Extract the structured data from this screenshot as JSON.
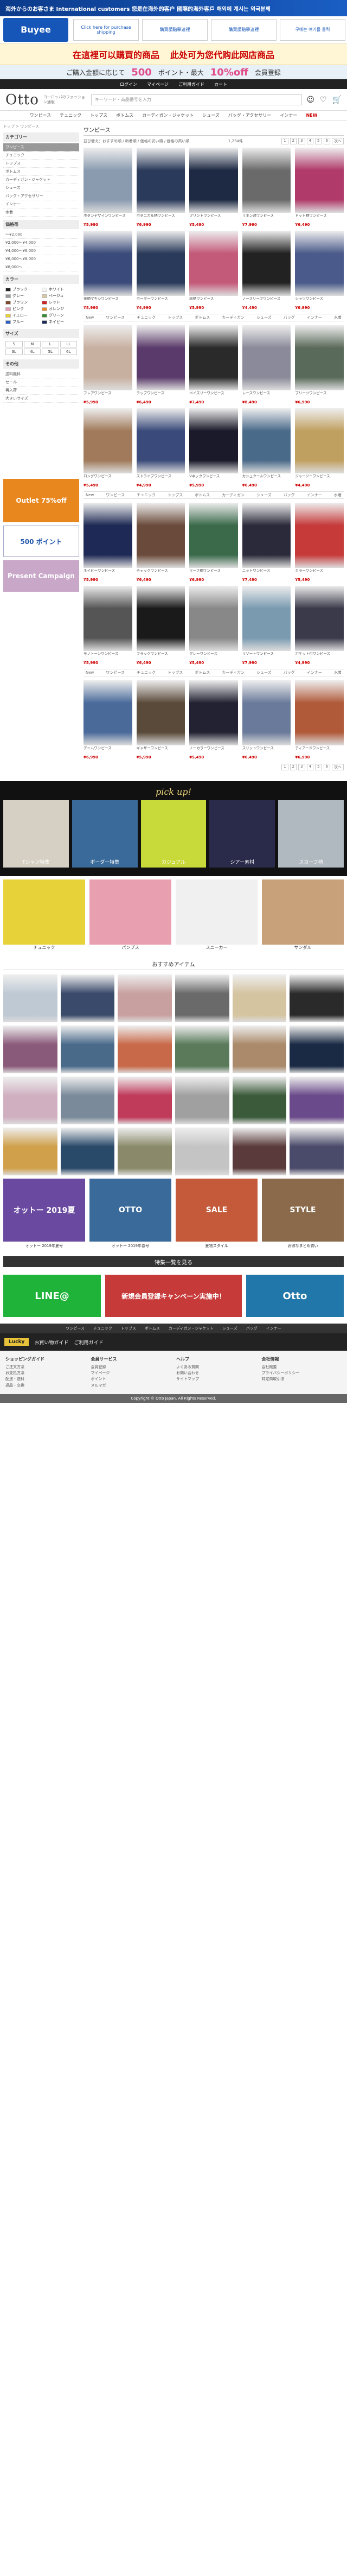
{
  "topbar": {
    "text": "海外からのお客さま International customers 您是在海外的客户 國際的海外客戶 해외에 계시는 외국분께"
  },
  "buyee": {
    "logo": "Buyee",
    "boxes": [
      "Click here for purchase shipping",
      "購買請點擊這裡",
      "購買請點擊這裡",
      "구매는 여기를 클릭"
    ]
  },
  "promo": {
    "line1": "在這裡可以購買的商品",
    "line2": "此处可为您代购此网店商品"
  },
  "points": {
    "left": "ご購入金額に応じて",
    "num": "500",
    "mid": "ポイント・最大",
    "pct": "10%off",
    "right": "会員登録"
  },
  "navbar": [
    "ログイン",
    "マイページ",
    "ご利用ガイド",
    "カート"
  ],
  "header": {
    "logo": "Otto",
    "tagline": "ヨーロッパのファッション通販",
    "search_ph": "キーワード・商品番号を入力"
  },
  "catnav": [
    "ワンピース",
    "チュニック",
    "トップス",
    "ボトムス",
    "カーディガン・ジャケット",
    "シューズ",
    "バッグ・アクセサリー",
    "インナー",
    "NEW"
  ],
  "side": {
    "crumb": "トップ > ワンピース",
    "h1": "カテゴリー",
    "cats": [
      "ワンピース",
      "チュニック",
      "トップス",
      "ボトムス",
      "カーディガン・ジャケット",
      "シューズ",
      "バッグ・アクセサリー",
      "インナー",
      "水着"
    ],
    "h2": "価格帯",
    "prices": [
      "〜¥2,000",
      "¥2,000〜¥4,000",
      "¥4,000〜¥6,000",
      "¥6,000〜¥8,000",
      "¥8,000〜"
    ],
    "h3": "カラー",
    "colors": [
      {
        "n": "ブラック",
        "c": "#222"
      },
      {
        "n": "ホワイト",
        "c": "#f5f5f5"
      },
      {
        "n": "グレー",
        "c": "#999"
      },
      {
        "n": "ベージュ",
        "c": "#d9c7a4"
      },
      {
        "n": "ブラウン",
        "c": "#7a4a2a"
      },
      {
        "n": "レッド",
        "c": "#c62828"
      },
      {
        "n": "ピンク",
        "c": "#e89bb5"
      },
      {
        "n": "オレンジ",
        "c": "#e88a2a"
      },
      {
        "n": "イエロー",
        "c": "#e8cf3a"
      },
      {
        "n": "グリーン",
        "c": "#3a8a3a"
      },
      {
        "n": "ブルー",
        "c": "#2a5ec4"
      },
      {
        "n": "ネイビー",
        "c": "#1a2a55"
      }
    ],
    "h4": "サイズ",
    "sizes": [
      "S",
      "M",
      "L",
      "LL",
      "3L",
      "4L",
      "5L",
      "6L"
    ],
    "h5": "その他",
    "others": [
      "送料無料",
      "セール",
      "再入荷",
      "大きいサイズ"
    ],
    "outlet": "Outlet 75%off",
    "newbie": "500 ポイント",
    "present": "Present Campaign"
  },
  "content": {
    "title": "ワンピース",
    "sort": "並び替え：おすすめ順 / 新着順 / 価格の安い順 / 価格の高い順",
    "count": "1,234件",
    "pages": [
      "1",
      "2",
      "3",
      "4",
      "5",
      "6",
      "次へ"
    ],
    "rowtag": [
      "New",
      "ワンピース",
      "チュニック",
      "トップス",
      "ボトムス",
      "カーディガン",
      "シューズ",
      "バッグ",
      "インナー",
      "水着"
    ]
  },
  "products": [
    {
      "n": "ボタンデザインワンピース",
      "p": "¥5,990",
      "c": "#8a9bb0"
    },
    {
      "n": "ボタニカル柄ワンピース",
      "p": "¥6,990",
      "c": "#2a3a5a"
    },
    {
      "n": "プリントワンピース",
      "p": "¥5,490",
      "c": "#1e2a44"
    },
    {
      "n": "リネン混ワンピース",
      "p": "¥7,990",
      "c": "#6a6a6a"
    },
    {
      "n": "ドット柄ワンピース",
      "p": "¥6,490",
      "c": "#b03a6a"
    },
    {
      "n": "花柄マキシワンピース",
      "p": "¥8,990",
      "c": "#3a4a7a"
    },
    {
      "n": "ボーダーワンピース",
      "p": "¥4,990",
      "c": "#2a3a5a"
    },
    {
      "n": "総柄ワンピース",
      "p": "¥5,990",
      "c": "#c45a7a"
    },
    {
      "n": "ノースリーブワンピース",
      "p": "¥4,490",
      "c": "#222"
    },
    {
      "n": "シャツワンピース",
      "p": "¥6,990",
      "c": "#4a5a8a"
    },
    {
      "n": "フレアワンピース",
      "p": "¥5,990",
      "c": "#c8b0a0"
    },
    {
      "n": "ラップワンピース",
      "p": "¥6,490",
      "c": "#5a3a6a"
    },
    {
      "n": "ペイズリーワンピース",
      "p": "¥7,490",
      "c": "#2a2a2a"
    },
    {
      "n": "レースワンピース",
      "p": "¥8,490",
      "c": "#8a8a9a"
    },
    {
      "n": "プリーツワンピース",
      "p": "¥6,990",
      "c": "#5a6a5a"
    },
    {
      "n": "ロングワンピース",
      "p": "¥5,490",
      "c": "#a07a5a"
    },
    {
      "n": "ストライプワンピース",
      "p": "¥4,990",
      "c": "#3a4a7a"
    },
    {
      "n": "Vネックワンピース",
      "p": "¥5,990",
      "c": "#1a1a2a"
    },
    {
      "n": "カシュクールワンピース",
      "p": "¥6,490",
      "c": "#4a6a8a"
    },
    {
      "n": "ジャージーワンピース",
      "p": "¥4,490",
      "c": "#c0a060"
    },
    {
      "n": "ネイビーワンピース",
      "p": "¥5,990",
      "c": "#1e2a55"
    },
    {
      "n": "チェックワンピース",
      "p": "¥6,490",
      "c": "#6a4a3a"
    },
    {
      "n": "リーフ柄ワンピース",
      "p": "¥6,990",
      "c": "#3a6a4a"
    },
    {
      "n": "ニットワンピース",
      "p": "¥7,490",
      "c": "#2a2a3a"
    },
    {
      "n": "カラーワンピース",
      "p": "¥5,490",
      "c": "#c63a3a"
    },
    {
      "n": "モノトーンワンピース",
      "p": "¥5,990",
      "c": "#555"
    },
    {
      "n": "ブラックワンピース",
      "p": "¥6,490",
      "c": "#1a1a1a"
    },
    {
      "n": "グレーワンピース",
      "p": "¥5,490",
      "c": "#888"
    },
    {
      "n": "リゾートワンピース",
      "p": "¥7,990",
      "c": "#7a9ab0"
    },
    {
      "n": "ポケット付ワンピース",
      "p": "¥4,990",
      "c": "#3a3a4a"
    },
    {
      "n": "デニムワンピース",
      "p": "¥6,990",
      "c": "#4a6a9a"
    },
    {
      "n": "ギャザーワンピース",
      "p": "¥5,990",
      "c": "#5a4a3a"
    },
    {
      "n": "ノーカラーワンピース",
      "p": "¥5,490",
      "c": "#223"
    },
    {
      "n": "スリットワンピース",
      "p": "¥6,490",
      "c": "#6a7a9a"
    },
    {
      "n": "ティアードワンピース",
      "p": "¥6,990",
      "c": "#b05a3a"
    }
  ],
  "pickup": {
    "title": "pick up!",
    "items": [
      "Tシャツ特集",
      "ボーダー特集",
      "カジュアル",
      "シアー素材",
      "スカーフ柄"
    ]
  },
  "lower_cells": [
    "チュニック",
    "パンプス",
    "スニーカー",
    "サンダル"
  ],
  "recommend": {
    "title": "おすすめアイテム"
  },
  "features": [
    {
      "t": "オットー 2019夏",
      "c": "#6a4aa0",
      "cap": "オットー 2019年夏号"
    },
    {
      "t": "OTTO",
      "c": "#3a6a9a",
      "cap": "オットー 2019年春号"
    },
    {
      "t": "SALE",
      "c": "#c45a3a",
      "cap": "夏物スタイル"
    },
    {
      "t": "STYLE",
      "c": "#8a6a4a",
      "cap": "お得なまとめ買い"
    }
  ],
  "feature_btn": "特集一覧を見る",
  "line": {
    "left": "LINE@",
    "mid": "新規会員登録キャンペーン実施中！",
    "right": "Otto"
  },
  "footer_nav": [
    "ワンピース",
    "チュニック",
    "トップス",
    "ボトムス",
    "カーディガン・ジャケット",
    "シューズ",
    "バッグ",
    "インナー"
  ],
  "foot_banner": {
    "a": "Lucky",
    "b": "お買い物ガイド",
    "c": "ご利用ガイド"
  },
  "footer": [
    {
      "h": "ショッピングガイド",
      "l": [
        "ご注文方法",
        "お支払方法",
        "配送・送料",
        "返品・交換"
      ]
    },
    {
      "h": "会員サービス",
      "l": [
        "会員登録",
        "マイページ",
        "ポイント",
        "メルマガ"
      ]
    },
    {
      "h": "ヘルプ",
      "l": [
        "よくある質問",
        "お問い合わせ",
        "サイトマップ"
      ]
    },
    {
      "h": "会社情報",
      "l": [
        "会社概要",
        "プライバシーポリシー",
        "特定商取引法"
      ]
    }
  ],
  "copyright": "Copyright © Otto Japan. All Rights Reserved."
}
